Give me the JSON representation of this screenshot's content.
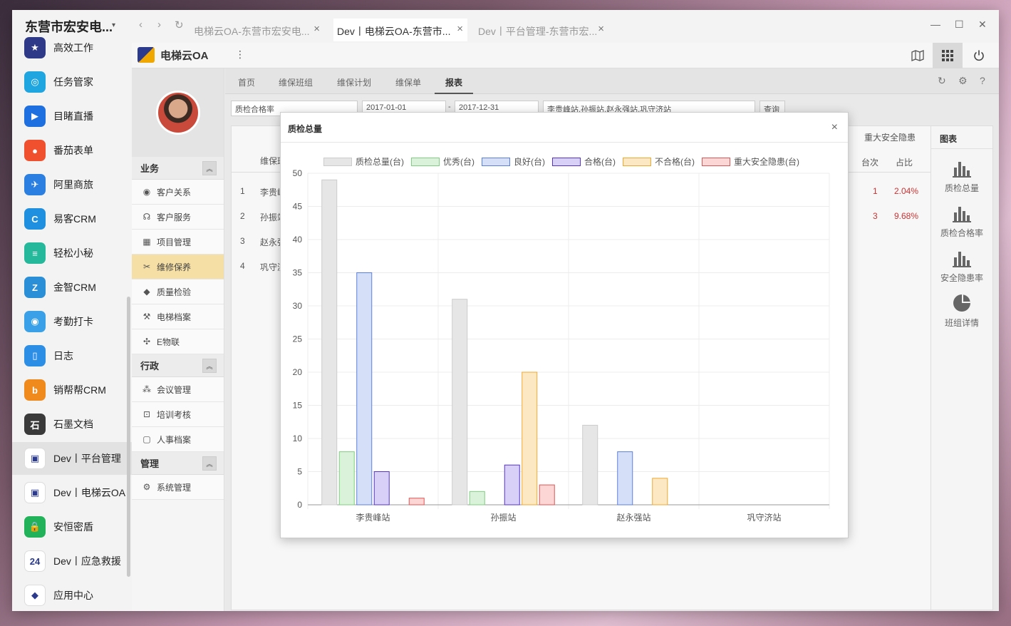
{
  "org": {
    "name": "东营市宏安电...",
    "arrow": "▾"
  },
  "apps": [
    {
      "label": "高效工作",
      "icon": "star-icon",
      "color": "#2e3a87",
      "glyph": "★"
    },
    {
      "label": "任务管家",
      "icon": "task-icon",
      "color": "#1fa5e0",
      "glyph": "◎"
    },
    {
      "label": "目睹直播",
      "icon": "play-icon",
      "color": "#1e6fe0",
      "glyph": "▶"
    },
    {
      "label": "番茄表单",
      "icon": "tomato-icon",
      "color": "#f0502d",
      "glyph": "●"
    },
    {
      "label": "阿里商旅",
      "icon": "plane-icon",
      "color": "#2b7fe0",
      "glyph": "✈"
    },
    {
      "label": "易客CRM",
      "icon": "crm-icon",
      "color": "#1f8fe0",
      "glyph": "C"
    },
    {
      "label": "轻松小秘",
      "icon": "notebook-icon",
      "color": "#26b89a",
      "glyph": "≡"
    },
    {
      "label": "金智CRM",
      "icon": "chart-icon",
      "color": "#2a8fd6",
      "glyph": "Z"
    },
    {
      "label": "考勤打卡",
      "icon": "location-icon",
      "color": "#3aa0e8",
      "glyph": "◉"
    },
    {
      "label": "日志",
      "icon": "log-icon",
      "color": "#2d8ee6",
      "glyph": "▯"
    },
    {
      "label": "销帮帮CRM",
      "icon": "b-icon",
      "color": "#f08a1c",
      "glyph": "b"
    },
    {
      "label": "石墨文档",
      "icon": "shimo-icon",
      "color": "#3a3a3a",
      "glyph": "石"
    },
    {
      "label": "Dev丨平台管理",
      "icon": "platform-icon",
      "color": "#ffffff",
      "glyph": "▣",
      "selected": true
    },
    {
      "label": "Dev丨电梯云OA",
      "icon": "elevator-oa-icon",
      "color": "#ffffff",
      "glyph": "▣"
    },
    {
      "label": "安恒密盾",
      "icon": "lock-icon",
      "color": "#22b35a",
      "glyph": "🔒"
    },
    {
      "label": "Dev丨应急救援",
      "icon": "rescue-icon",
      "color": "#ffffff",
      "glyph": "24"
    },
    {
      "label": "应用中心",
      "icon": "app-center-icon",
      "color": "#ffffff",
      "glyph": "◆"
    }
  ],
  "browser": {
    "tabs": [
      {
        "label": "电梯云OA-东营市宏安电...",
        "active": false
      },
      {
        "label": "Dev丨电梯云OA-东营市...",
        "active": true
      },
      {
        "label": "Dev丨平台管理-东营市宏...",
        "active": false
      }
    ],
    "close": "×",
    "back": "‹",
    "forward": "›",
    "reload": "↻",
    "minimize": "—",
    "maximize": "☐",
    "close_window": "✕"
  },
  "app": {
    "logo": "电梯云OA",
    "more": "⋮"
  },
  "module_sidebar": {
    "sections": [
      {
        "title": "业务",
        "items": [
          {
            "label": "客户关系",
            "icon": "crm-badge-icon",
            "glyph": "◉"
          },
          {
            "label": "客户服务",
            "icon": "headset-icon",
            "glyph": "☊"
          },
          {
            "label": "项目管理",
            "icon": "project-icon",
            "glyph": "▦"
          },
          {
            "label": "维修保养",
            "icon": "tools-icon",
            "glyph": "✂",
            "selected": true
          },
          {
            "label": "质量检验",
            "icon": "shield-icon",
            "glyph": "◆"
          },
          {
            "label": "电梯档案",
            "icon": "wrench-icon",
            "glyph": "⚒"
          },
          {
            "label": "E物联",
            "icon": "iot-icon",
            "glyph": "✣"
          }
        ]
      },
      {
        "title": "行政",
        "items": [
          {
            "label": "会议管理",
            "icon": "meeting-icon",
            "glyph": "⁂"
          },
          {
            "label": "培训考核",
            "icon": "training-icon",
            "glyph": "⊡"
          },
          {
            "label": "人事档案",
            "icon": "personnel-icon",
            "glyph": "▢"
          }
        ]
      },
      {
        "title": "管理",
        "items": [
          {
            "label": "系统管理",
            "icon": "settings-icon",
            "glyph": "⚙"
          }
        ]
      }
    ],
    "collapse": "︽"
  },
  "content_tabs": [
    {
      "label": "首页",
      "active": false
    },
    {
      "label": "维保班组",
      "active": false
    },
    {
      "label": "维保计划",
      "active": false
    },
    {
      "label": "维保单",
      "active": false
    },
    {
      "label": "报表",
      "active": true
    }
  ],
  "filters": {
    "metric": "质检合格率",
    "date_from": "2017-01-01",
    "date_sep": "-",
    "date_to": "2017-12-31",
    "stations": "李贵峰站,孙振站,赵永强站,巩守济站",
    "query": "查询"
  },
  "grid": {
    "header_left": "维保班",
    "header_right": "重大安全隐患",
    "sub_headers": [
      "台次",
      "占比"
    ],
    "rows": [
      {
        "idx": "1",
        "name": "李贵峰",
        "count": "1",
        "ratio": "2.04%"
      },
      {
        "idx": "2",
        "name": "孙振站",
        "count": "3",
        "ratio": "9.68%"
      },
      {
        "idx": "3",
        "name": "赵永强",
        "count": "",
        "ratio": ""
      },
      {
        "idx": "4",
        "name": "巩守济",
        "count": "",
        "ratio": ""
      }
    ]
  },
  "charts_panel": {
    "title": "图表",
    "items": [
      {
        "label": "质检总量",
        "icon": "bar-chart-icon"
      },
      {
        "label": "质检合格率",
        "icon": "bar-chart-icon"
      },
      {
        "label": "安全隐患率",
        "icon": "bar-chart-icon"
      },
      {
        "label": "班组详情",
        "icon": "pie-chart-icon"
      }
    ]
  },
  "modal": {
    "title": "质检总量",
    "close": "×"
  },
  "chart_data": {
    "type": "bar",
    "categories": [
      "李贵峰站",
      "孙振站",
      "赵永强站",
      "巩守济站"
    ],
    "series": [
      {
        "name": "质检总量(台)",
        "values": [
          49,
          31,
          12,
          0
        ],
        "fill": "#e6e6e6",
        "stroke": "#cccccc"
      },
      {
        "name": "优秀(台)",
        "values": [
          8,
          2,
          0,
          0
        ],
        "fill": "#d9f2d9",
        "stroke": "#7fd07f"
      },
      {
        "name": "良好(台)",
        "values": [
          35,
          0,
          8,
          0
        ],
        "fill": "#d5e0f8",
        "stroke": "#5b7fe0"
      },
      {
        "name": "合格(台)",
        "values": [
          5,
          6,
          0,
          0
        ],
        "fill": "#d9d0f8",
        "stroke": "#5533cc"
      },
      {
        "name": "不合格(台)",
        "values": [
          0,
          20,
          4,
          0
        ],
        "fill": "#fde8c4",
        "stroke": "#f0a830"
      },
      {
        "name": "重大安全隐患(台)",
        "values": [
          1,
          3,
          0,
          0
        ],
        "fill": "#fcd5d5",
        "stroke": "#e05555"
      }
    ],
    "ylim": [
      0,
      50
    ],
    "yticks": [
      0,
      5,
      10,
      15,
      20,
      25,
      30,
      35,
      40,
      45,
      50
    ],
    "grid": true,
    "legend": "top"
  }
}
